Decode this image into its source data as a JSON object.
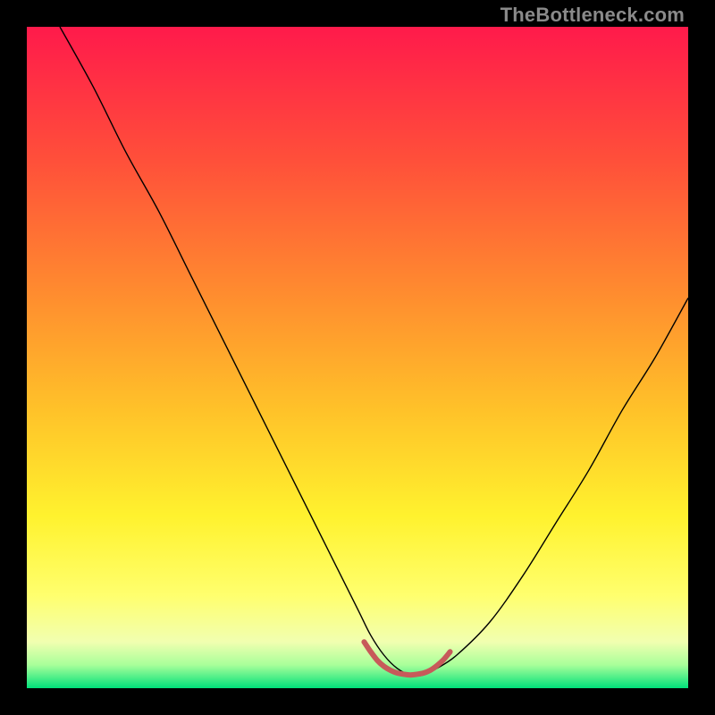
{
  "watermark": "TheBottleneck.com",
  "chart_data": {
    "type": "line",
    "title": "",
    "xlabel": "",
    "ylabel": "",
    "xlim": [
      0,
      100
    ],
    "ylim": [
      0,
      100
    ],
    "grid": false,
    "legend": false,
    "background_gradient_stops": [
      {
        "offset": 0.0,
        "color": "#ff1a4b"
      },
      {
        "offset": 0.2,
        "color": "#ff4f3a"
      },
      {
        "offset": 0.4,
        "color": "#ff8b2f"
      },
      {
        "offset": 0.58,
        "color": "#ffc229"
      },
      {
        "offset": 0.74,
        "color": "#fff22e"
      },
      {
        "offset": 0.86,
        "color": "#ffff6e"
      },
      {
        "offset": 0.93,
        "color": "#f1ffb0"
      },
      {
        "offset": 0.965,
        "color": "#a8ff9a"
      },
      {
        "offset": 1.0,
        "color": "#00e07a"
      }
    ],
    "series": [
      {
        "name": "bottleneck-curve",
        "stroke": "#000000",
        "stroke_width": 1.4,
        "x": [
          5,
          10,
          15,
          20,
          25,
          30,
          35,
          40,
          45,
          50,
          52,
          54,
          56,
          58,
          60,
          62,
          65,
          70,
          75,
          80,
          85,
          90,
          95,
          100
        ],
        "y": [
          100,
          91,
          81,
          72,
          62,
          52,
          42,
          32,
          22,
          12,
          8,
          5,
          3,
          2,
          2,
          3,
          5,
          10,
          17,
          25,
          33,
          42,
          50,
          59
        ]
      },
      {
        "name": "sweet-spot",
        "stroke": "#c75a5a",
        "stroke_width": 6,
        "x": [
          51,
          52,
          53,
          54,
          55,
          56,
          57,
          58,
          59,
          60,
          61,
          62,
          63,
          64
        ],
        "y": [
          7,
          5.5,
          4.2,
          3.3,
          2.7,
          2.3,
          2.1,
          2.0,
          2.1,
          2.3,
          2.7,
          3.4,
          4.3,
          5.5
        ]
      }
    ]
  }
}
